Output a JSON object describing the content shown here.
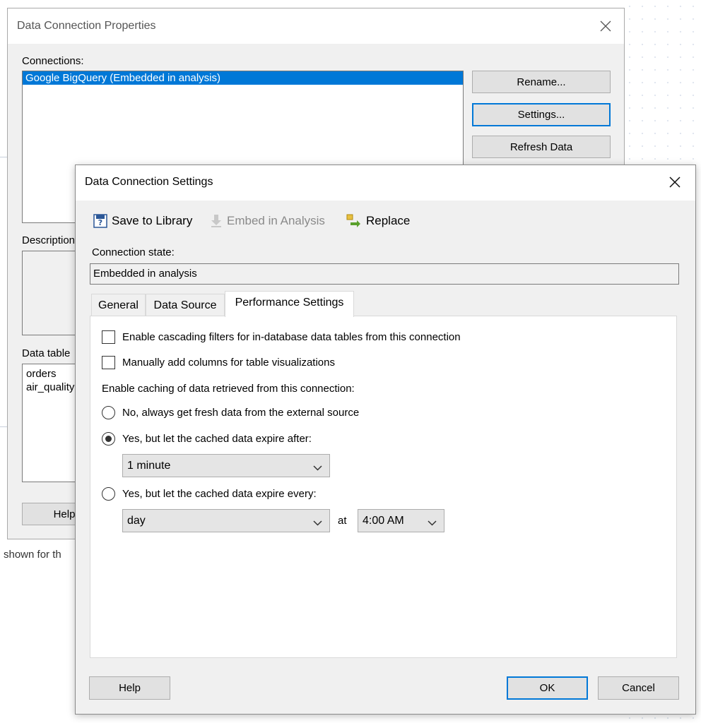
{
  "background": {
    "status_text": "shown for th"
  },
  "outer_dialog": {
    "title": "Data Connection Properties",
    "connections_label": "Connections:",
    "connections": [
      "Google BigQuery (Embedded in analysis)"
    ],
    "buttons": {
      "rename": "Rename...",
      "settings": "Settings...",
      "refresh": "Refresh Data",
      "help": "Help"
    },
    "description_label": "Description",
    "data_tables_label": "Data table",
    "data_tables": [
      "orders",
      "air_quality"
    ]
  },
  "inner_dialog": {
    "title": "Data Connection Settings",
    "toolbar": {
      "save_to_library": "Save to Library",
      "embed_in_analysis": "Embed in Analysis",
      "replace": "Replace"
    },
    "connection_state_label": "Connection state:",
    "connection_state_value": "Embedded in analysis",
    "tabs": [
      {
        "label": "General",
        "active": false
      },
      {
        "label": "Data Source",
        "active": false
      },
      {
        "label": "Performance Settings",
        "active": true
      }
    ],
    "performance": {
      "cascading_filters": {
        "label": "Enable cascading filters for in-database data tables from this connection",
        "checked": false
      },
      "manual_columns": {
        "label": "Manually add columns for table visualizations",
        "checked": false
      },
      "caching_label": "Enable caching of data retrieved from this connection:",
      "radio_no": {
        "label": "No, always get fresh data from the external source",
        "selected": false
      },
      "radio_expire_after": {
        "label": "Yes, but let the cached data expire after:",
        "selected": true
      },
      "expire_after_value": "1 minute",
      "radio_expire_every": {
        "label": "Yes, but let the cached data expire every:",
        "selected": false
      },
      "expire_every_value": "day",
      "at_label": "at",
      "time_value": "4:00 AM"
    },
    "buttons": {
      "help": "Help",
      "ok": "OK",
      "cancel": "Cancel"
    }
  },
  "colors": {
    "selection": "#0078d7",
    "dialog_bg": "#f0f0f0"
  }
}
